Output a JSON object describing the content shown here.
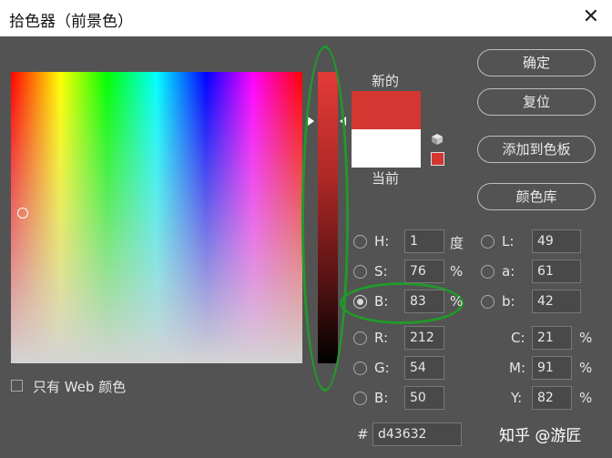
{
  "window": {
    "title": "拾色器（前景色）"
  },
  "swatches": {
    "new_label": "新的",
    "current_label": "当前",
    "new_color": "#d43632",
    "current_color": "#ffffff"
  },
  "buttons": {
    "ok": "确定",
    "reset": "复位",
    "add_swatch": "添加到色板",
    "libraries": "颜色库"
  },
  "hsb": {
    "h_label": "H:",
    "h_value": "1",
    "h_unit": "度",
    "s_label": "S:",
    "s_value": "76",
    "s_unit": "%",
    "b_label": "B:",
    "b_value": "83",
    "b_unit": "%"
  },
  "lab": {
    "l_label": "L:",
    "l_value": "49",
    "a_label": "a:",
    "a_value": "61",
    "b_label": "b:",
    "b_value": "42"
  },
  "rgb": {
    "r_label": "R:",
    "r_value": "212",
    "g_label": "G:",
    "g_value": "54",
    "b_label": "B:",
    "b_value": "50"
  },
  "cmyk": {
    "c_label": "C:",
    "c_value": "21",
    "c_unit": "%",
    "m_label": "M:",
    "m_value": "91",
    "m_unit": "%",
    "y_label": "Y:",
    "y_value": "82",
    "y_unit": "%"
  },
  "hex": {
    "label": "#",
    "value": "d43632"
  },
  "web_only": {
    "label": "只有 Web 颜色"
  },
  "watermark": "知乎 @游匠",
  "icons": [
    "close-icon",
    "cube-icon",
    "gamut-warning-icon"
  ],
  "annotation_color": "#22992a"
}
